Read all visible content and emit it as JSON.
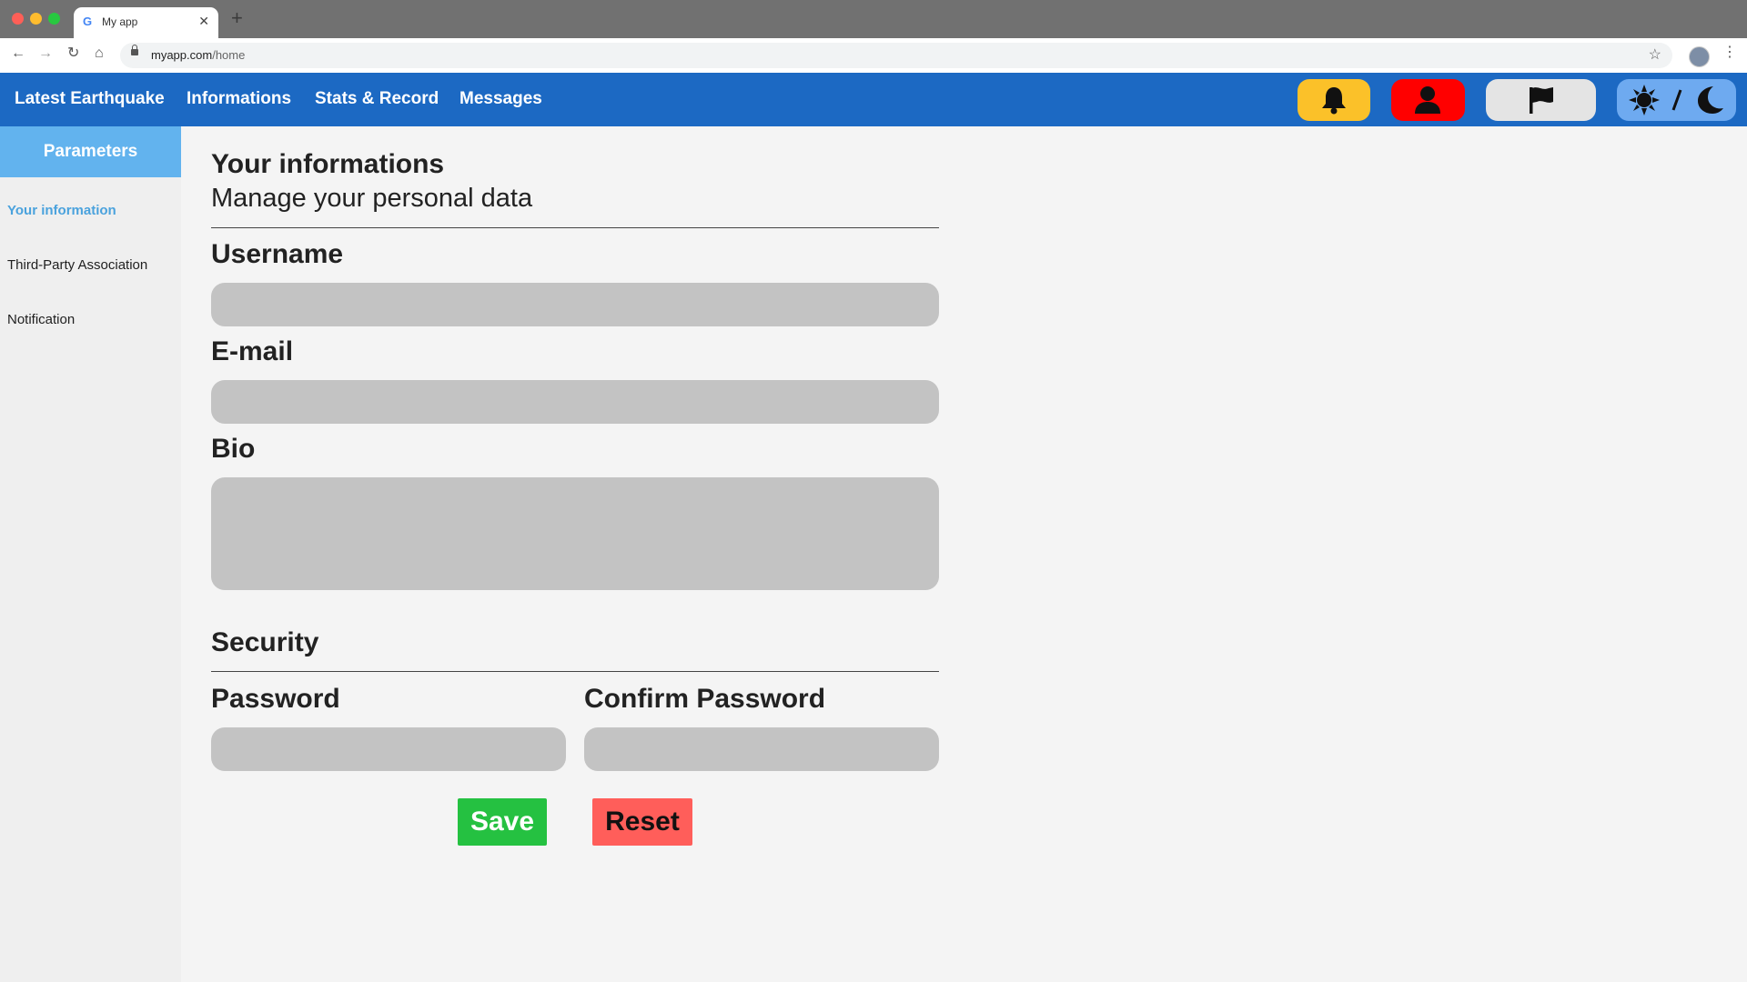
{
  "browser": {
    "tab_title": "My app",
    "tab_favicon": "G",
    "url_host": "myapp.com",
    "url_path": "/home",
    "icons": [
      "back-arrow-icon",
      "forward-arrow-icon",
      "reload-icon",
      "home-icon",
      "lock-icon",
      "star-icon",
      "profile-avatar",
      "kebab-menu-icon"
    ]
  },
  "nav": {
    "links": [
      "Latest Earthquake",
      "Informations",
      "Stats & Record",
      "Messages"
    ],
    "buttons": [
      {
        "icon": "bell-icon",
        "color": "#fbc129"
      },
      {
        "icon": "user-icon",
        "color": "#ff0000"
      },
      {
        "icon": "flag-icon",
        "color": "#e4e4e4"
      },
      {
        "icon": "sun-moon-icon",
        "color": "#6eaaf0",
        "separator": "/"
      }
    ],
    "background": "#1c69c3"
  },
  "sidebar": {
    "header": "Parameters",
    "header_color": "#62b3ee",
    "items": [
      {
        "label": "Your information",
        "active": true
      },
      {
        "label": "Third-Party Association",
        "active": false
      },
      {
        "label": "Notification",
        "active": false
      }
    ]
  },
  "main": {
    "title": "Your informations",
    "subtitle": "Manage your personal data",
    "fields": {
      "username": {
        "label": "Username",
        "value": ""
      },
      "email": {
        "label": "E-mail",
        "value": ""
      },
      "bio": {
        "label": "Bio",
        "value": ""
      }
    },
    "security": {
      "heading": "Security",
      "password": {
        "label": "Password",
        "value": ""
      },
      "confirm_password": {
        "label": "Confirm Password",
        "value": ""
      }
    },
    "buttons": {
      "save": {
        "label": "Save",
        "color": "#25c141"
      },
      "reset": {
        "label": "Reset",
        "color": "#ff5e5a"
      }
    }
  }
}
